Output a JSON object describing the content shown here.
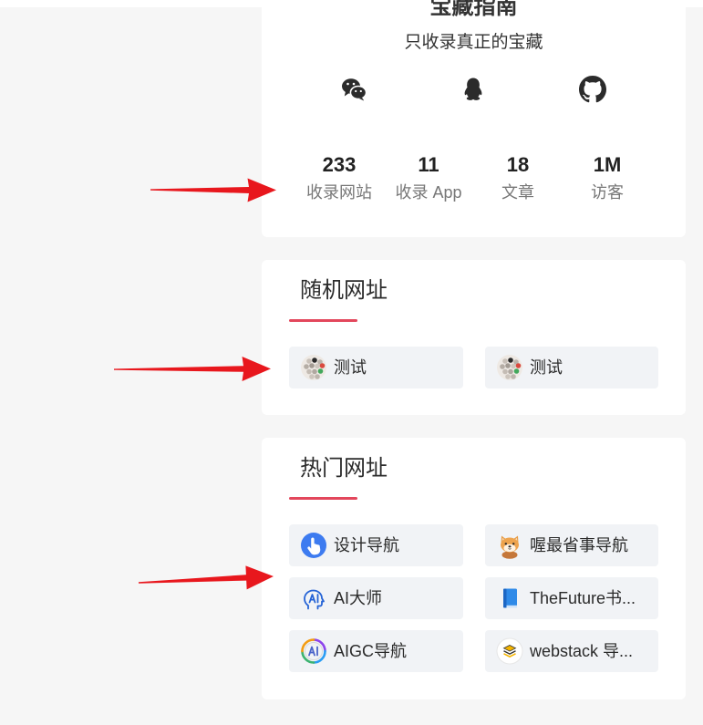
{
  "colors": {
    "page_bg": "#f6f6f6",
    "card_bg": "#ffffff",
    "text": "#333333",
    "muted": "#777777",
    "accent": "#e3475c",
    "item_bg": "#f1f3f6",
    "annotation": "#e8171d"
  },
  "profile": {
    "title": "宝藏指南",
    "subtitle": "只收录真正的宝藏",
    "social": [
      {
        "icon": "wechat-icon"
      },
      {
        "icon": "qq-icon"
      },
      {
        "icon": "github-icon"
      }
    ],
    "stats": [
      {
        "value": "233",
        "label": "收录网站"
      },
      {
        "value": "11",
        "label": "收录 App"
      },
      {
        "value": "18",
        "label": "文章"
      },
      {
        "value": "1M",
        "label": "访客"
      }
    ]
  },
  "random_sites": {
    "title": "随机网址",
    "items": [
      {
        "label": "测试",
        "icon": "dotted-globe-icon"
      },
      {
        "label": "测试",
        "icon": "dotted-globe-icon"
      }
    ]
  },
  "hot_sites": {
    "title": "热门网址",
    "items": [
      {
        "label": "设计导航",
        "icon": "pointer-hand-icon"
      },
      {
        "label": "喔最省事导航",
        "icon": "shiba-dog-icon"
      },
      {
        "label": "AI大师",
        "icon": "ai-head-icon"
      },
      {
        "label": "TheFuture书...",
        "icon": "book-icon"
      },
      {
        "label": "AIGC导航",
        "icon": "aigc-ring-icon"
      },
      {
        "label": "webstack 导...",
        "icon": "stack-icon"
      }
    ]
  }
}
